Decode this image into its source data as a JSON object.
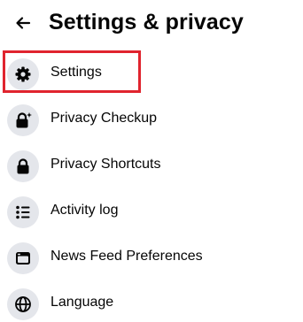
{
  "header": {
    "back_icon": "back-arrow-icon",
    "title": "Settings & privacy"
  },
  "menu": {
    "items": [
      {
        "label": "Settings",
        "icon": "gear-icon"
      },
      {
        "label": "Privacy Checkup",
        "icon": "lock-sparkle-icon"
      },
      {
        "label": "Privacy Shortcuts",
        "icon": "lock-icon"
      },
      {
        "label": "Activity log",
        "icon": "list-icon"
      },
      {
        "label": "News Feed Preferences",
        "icon": "feed-icon"
      },
      {
        "label": "Language",
        "icon": "globe-icon"
      }
    ]
  },
  "highlight": {
    "color": "#e0242e"
  },
  "colors": {
    "icon_background": "#e4e6eb",
    "text": "#050505"
  }
}
